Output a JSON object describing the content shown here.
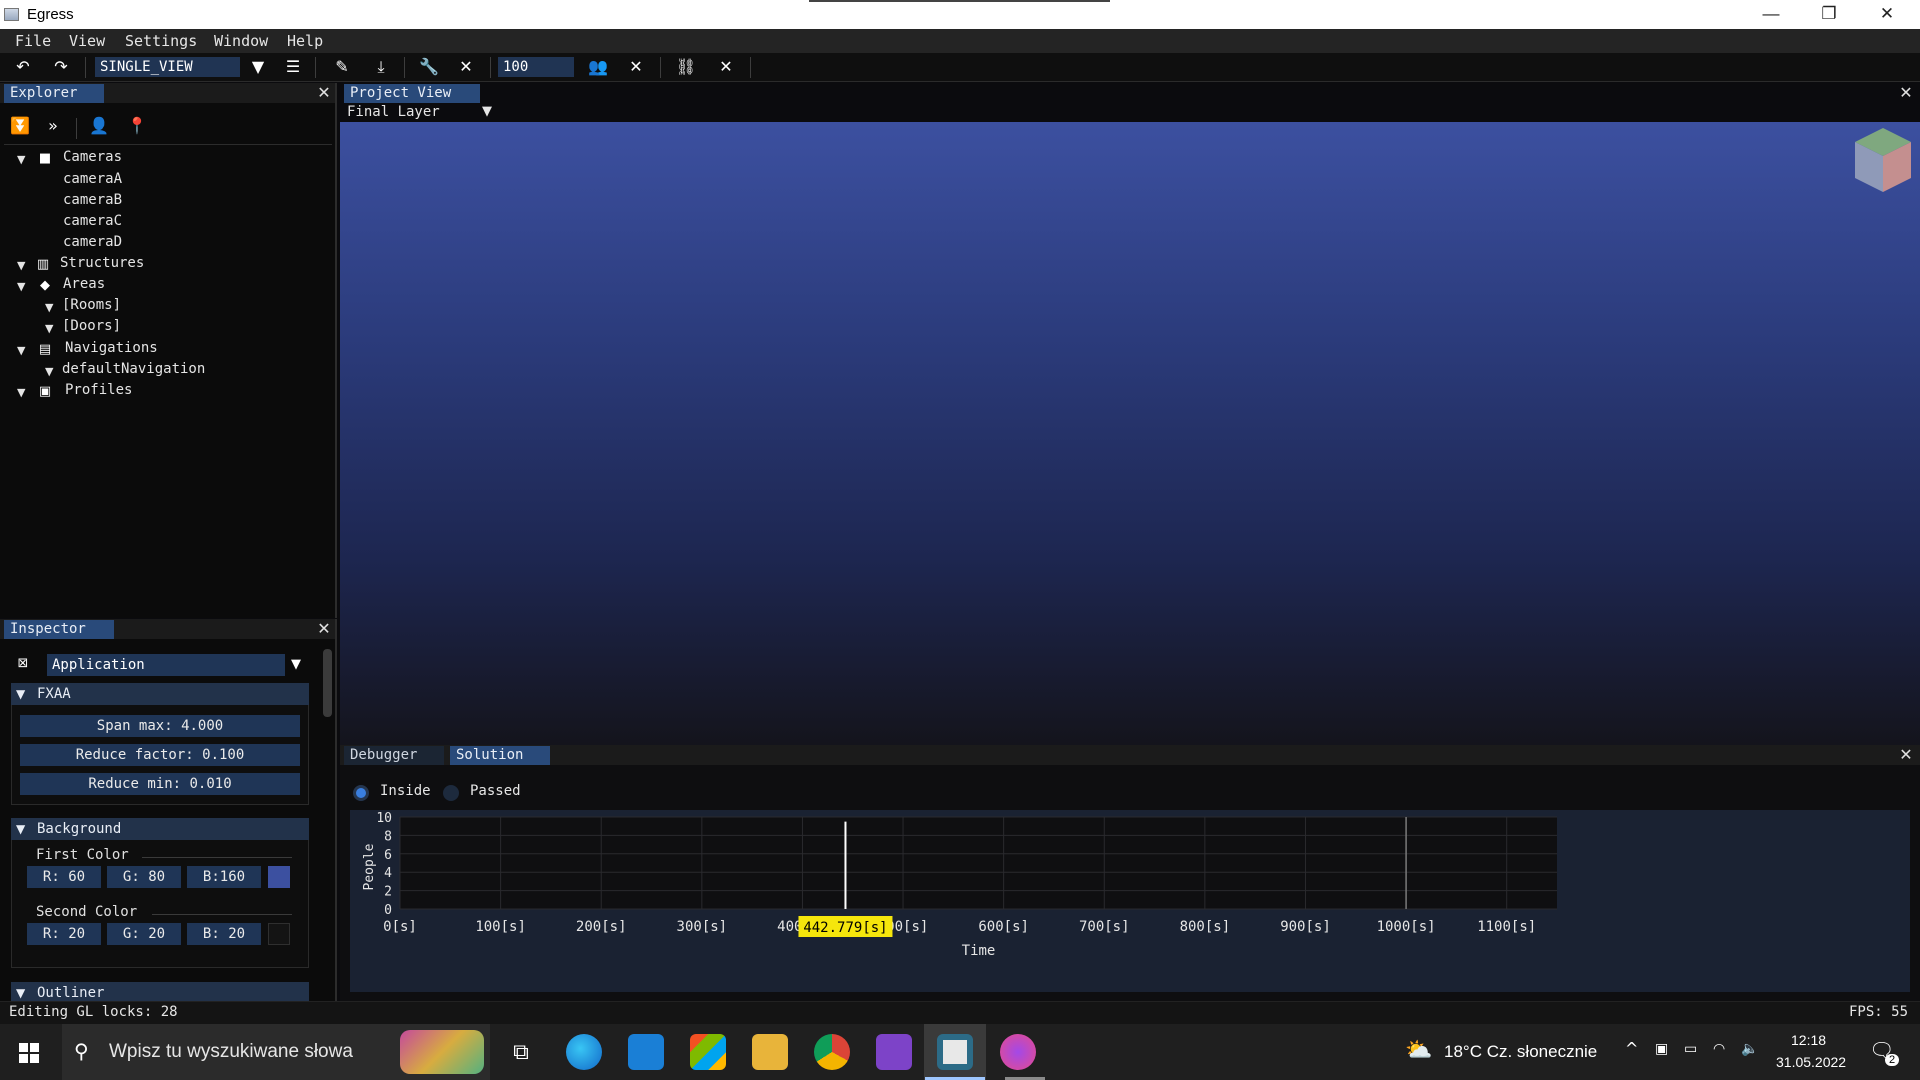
{
  "window": {
    "title": "Egress",
    "minimize": "—",
    "maximize": "❐",
    "close": "✕"
  },
  "menu": [
    "File",
    "View",
    "Settings",
    "Window",
    "Help"
  ],
  "toolbar": {
    "view_mode": "SINGLE_VIEW",
    "number_value": "100"
  },
  "explorer": {
    "tab": "Explorer",
    "tree": [
      {
        "label": "Cameras",
        "icon": "camera-icon",
        "children": [
          "cameraA",
          "cameraB",
          "cameraC",
          "cameraD"
        ]
      },
      {
        "label": "Structures",
        "icon": "building-icon"
      },
      {
        "label": "Areas",
        "icon": "tag-icon",
        "children": [
          "[Rooms]",
          "[Doors]"
        ]
      },
      {
        "label": "Navigations",
        "icon": "map-icon",
        "children": [
          "defaultNavigation"
        ]
      },
      {
        "label": "Profiles",
        "icon": "id-card-icon"
      }
    ]
  },
  "inspector": {
    "tab": "Inspector",
    "target": "Application",
    "fxaa": {
      "title": "FXAA",
      "span_max": "Span max: 4.000",
      "reduce_factor": "Reduce factor: 0.100",
      "reduce_min": "Reduce min: 0.010"
    },
    "background": {
      "title": "Background",
      "first_color": {
        "label": "First Color",
        "r": "R: 60",
        "g": "G: 80",
        "b": "B:160",
        "swatch": "#3c50a0"
      },
      "second_color": {
        "label": "Second Color",
        "r": "R: 20",
        "g": "G: 20",
        "b": "B: 20",
        "swatch": "#141414"
      }
    },
    "outliner": {
      "title": "Outliner"
    }
  },
  "project_view": {
    "tab": "Project View",
    "layer": "Final Layer"
  },
  "debugger": {
    "tabs": [
      "Debugger",
      "Solution"
    ],
    "radios": [
      {
        "label": "Inside",
        "selected": true
      },
      {
        "label": "Passed",
        "selected": false
      }
    ],
    "cursor_label": "442.779[s]"
  },
  "chart_data": {
    "type": "line",
    "xlabel": "Time",
    "ylabel": "People",
    "xlim": [
      0,
      1150
    ],
    "ylim": [
      0,
      10
    ],
    "x_ticks": [
      "0[s]",
      "100[s]",
      "200[s]",
      "300[s]",
      "400[s]",
      "500[s]",
      "600[s]",
      "700[s]",
      "800[s]",
      "900[s]",
      "1000[s]",
      "1100[s]"
    ],
    "y_ticks": [
      "0",
      "2",
      "4",
      "6",
      "8",
      "10"
    ],
    "grid": true,
    "cursor_x": 442.779,
    "cursor_x_label": "442.779[s]",
    "series": [
      {
        "values_x": [
          442.779,
          442.779
        ],
        "values_y": [
          0,
          9.5
        ]
      }
    ],
    "extra_vertical_line_x": 1000
  },
  "status": {
    "left": "Editing GL locks: 28",
    "right": "FPS: 55"
  },
  "taskbar": {
    "search_placeholder": "Wpisz tu wyszukiwane słowa",
    "weather": "18°C  Cz. słonecznie",
    "time": "12:18",
    "date": "31.05.2022",
    "notifications": "2"
  }
}
